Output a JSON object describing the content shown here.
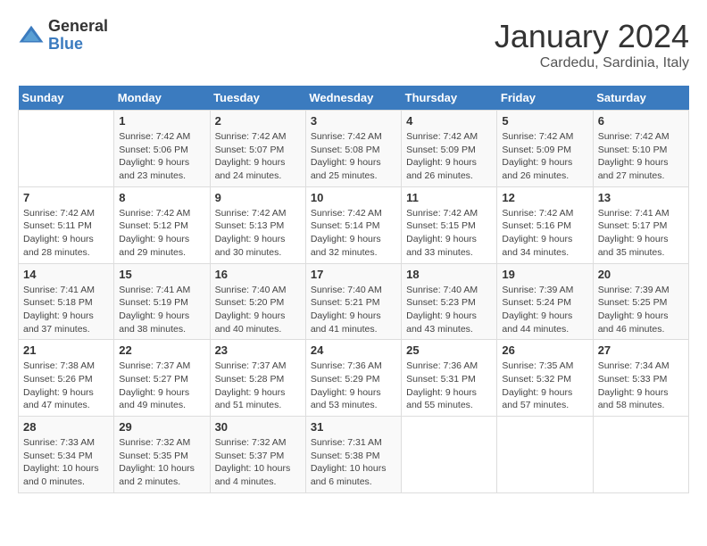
{
  "logo": {
    "general": "General",
    "blue": "Blue"
  },
  "title": "January 2024",
  "location": "Cardedu, Sardinia, Italy",
  "days_of_week": [
    "Sunday",
    "Monday",
    "Tuesday",
    "Wednesday",
    "Thursday",
    "Friday",
    "Saturday"
  ],
  "weeks": [
    [
      {
        "num": "",
        "info": ""
      },
      {
        "num": "1",
        "info": "Sunrise: 7:42 AM\nSunset: 5:06 PM\nDaylight: 9 hours\nand 23 minutes."
      },
      {
        "num": "2",
        "info": "Sunrise: 7:42 AM\nSunset: 5:07 PM\nDaylight: 9 hours\nand 24 minutes."
      },
      {
        "num": "3",
        "info": "Sunrise: 7:42 AM\nSunset: 5:08 PM\nDaylight: 9 hours\nand 25 minutes."
      },
      {
        "num": "4",
        "info": "Sunrise: 7:42 AM\nSunset: 5:09 PM\nDaylight: 9 hours\nand 26 minutes."
      },
      {
        "num": "5",
        "info": "Sunrise: 7:42 AM\nSunset: 5:09 PM\nDaylight: 9 hours\nand 26 minutes."
      },
      {
        "num": "6",
        "info": "Sunrise: 7:42 AM\nSunset: 5:10 PM\nDaylight: 9 hours\nand 27 minutes."
      }
    ],
    [
      {
        "num": "7",
        "info": "Sunrise: 7:42 AM\nSunset: 5:11 PM\nDaylight: 9 hours\nand 28 minutes."
      },
      {
        "num": "8",
        "info": "Sunrise: 7:42 AM\nSunset: 5:12 PM\nDaylight: 9 hours\nand 29 minutes."
      },
      {
        "num": "9",
        "info": "Sunrise: 7:42 AM\nSunset: 5:13 PM\nDaylight: 9 hours\nand 30 minutes."
      },
      {
        "num": "10",
        "info": "Sunrise: 7:42 AM\nSunset: 5:14 PM\nDaylight: 9 hours\nand 32 minutes."
      },
      {
        "num": "11",
        "info": "Sunrise: 7:42 AM\nSunset: 5:15 PM\nDaylight: 9 hours\nand 33 minutes."
      },
      {
        "num": "12",
        "info": "Sunrise: 7:42 AM\nSunset: 5:16 PM\nDaylight: 9 hours\nand 34 minutes."
      },
      {
        "num": "13",
        "info": "Sunrise: 7:41 AM\nSunset: 5:17 PM\nDaylight: 9 hours\nand 35 minutes."
      }
    ],
    [
      {
        "num": "14",
        "info": "Sunrise: 7:41 AM\nSunset: 5:18 PM\nDaylight: 9 hours\nand 37 minutes."
      },
      {
        "num": "15",
        "info": "Sunrise: 7:41 AM\nSunset: 5:19 PM\nDaylight: 9 hours\nand 38 minutes."
      },
      {
        "num": "16",
        "info": "Sunrise: 7:40 AM\nSunset: 5:20 PM\nDaylight: 9 hours\nand 40 minutes."
      },
      {
        "num": "17",
        "info": "Sunrise: 7:40 AM\nSunset: 5:21 PM\nDaylight: 9 hours\nand 41 minutes."
      },
      {
        "num": "18",
        "info": "Sunrise: 7:40 AM\nSunset: 5:23 PM\nDaylight: 9 hours\nand 43 minutes."
      },
      {
        "num": "19",
        "info": "Sunrise: 7:39 AM\nSunset: 5:24 PM\nDaylight: 9 hours\nand 44 minutes."
      },
      {
        "num": "20",
        "info": "Sunrise: 7:39 AM\nSunset: 5:25 PM\nDaylight: 9 hours\nand 46 minutes."
      }
    ],
    [
      {
        "num": "21",
        "info": "Sunrise: 7:38 AM\nSunset: 5:26 PM\nDaylight: 9 hours\nand 47 minutes."
      },
      {
        "num": "22",
        "info": "Sunrise: 7:37 AM\nSunset: 5:27 PM\nDaylight: 9 hours\nand 49 minutes."
      },
      {
        "num": "23",
        "info": "Sunrise: 7:37 AM\nSunset: 5:28 PM\nDaylight: 9 hours\nand 51 minutes."
      },
      {
        "num": "24",
        "info": "Sunrise: 7:36 AM\nSunset: 5:29 PM\nDaylight: 9 hours\nand 53 minutes."
      },
      {
        "num": "25",
        "info": "Sunrise: 7:36 AM\nSunset: 5:31 PM\nDaylight: 9 hours\nand 55 minutes."
      },
      {
        "num": "26",
        "info": "Sunrise: 7:35 AM\nSunset: 5:32 PM\nDaylight: 9 hours\nand 57 minutes."
      },
      {
        "num": "27",
        "info": "Sunrise: 7:34 AM\nSunset: 5:33 PM\nDaylight: 9 hours\nand 58 minutes."
      }
    ],
    [
      {
        "num": "28",
        "info": "Sunrise: 7:33 AM\nSunset: 5:34 PM\nDaylight: 10 hours\nand 0 minutes."
      },
      {
        "num": "29",
        "info": "Sunrise: 7:32 AM\nSunset: 5:35 PM\nDaylight: 10 hours\nand 2 minutes."
      },
      {
        "num": "30",
        "info": "Sunrise: 7:32 AM\nSunset: 5:37 PM\nDaylight: 10 hours\nand 4 minutes."
      },
      {
        "num": "31",
        "info": "Sunrise: 7:31 AM\nSunset: 5:38 PM\nDaylight: 10 hours\nand 6 minutes."
      },
      {
        "num": "",
        "info": ""
      },
      {
        "num": "",
        "info": ""
      },
      {
        "num": "",
        "info": ""
      }
    ]
  ]
}
